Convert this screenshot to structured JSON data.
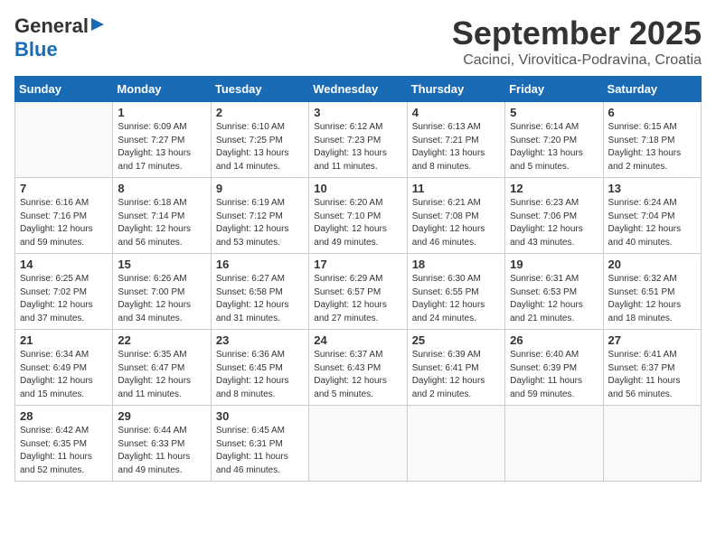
{
  "logo": {
    "general": "General",
    "blue": "Blue"
  },
  "title": "September 2025",
  "subtitle": "Cacinci, Virovitica-Podravina, Croatia",
  "days_of_week": [
    "Sunday",
    "Monday",
    "Tuesday",
    "Wednesday",
    "Thursday",
    "Friday",
    "Saturday"
  ],
  "weeks": [
    [
      {
        "day": "",
        "info": ""
      },
      {
        "day": "1",
        "info": "Sunrise: 6:09 AM\nSunset: 7:27 PM\nDaylight: 13 hours\nand 17 minutes."
      },
      {
        "day": "2",
        "info": "Sunrise: 6:10 AM\nSunset: 7:25 PM\nDaylight: 13 hours\nand 14 minutes."
      },
      {
        "day": "3",
        "info": "Sunrise: 6:12 AM\nSunset: 7:23 PM\nDaylight: 13 hours\nand 11 minutes."
      },
      {
        "day": "4",
        "info": "Sunrise: 6:13 AM\nSunset: 7:21 PM\nDaylight: 13 hours\nand 8 minutes."
      },
      {
        "day": "5",
        "info": "Sunrise: 6:14 AM\nSunset: 7:20 PM\nDaylight: 13 hours\nand 5 minutes."
      },
      {
        "day": "6",
        "info": "Sunrise: 6:15 AM\nSunset: 7:18 PM\nDaylight: 13 hours\nand 2 minutes."
      }
    ],
    [
      {
        "day": "7",
        "info": "Sunrise: 6:16 AM\nSunset: 7:16 PM\nDaylight: 12 hours\nand 59 minutes."
      },
      {
        "day": "8",
        "info": "Sunrise: 6:18 AM\nSunset: 7:14 PM\nDaylight: 12 hours\nand 56 minutes."
      },
      {
        "day": "9",
        "info": "Sunrise: 6:19 AM\nSunset: 7:12 PM\nDaylight: 12 hours\nand 53 minutes."
      },
      {
        "day": "10",
        "info": "Sunrise: 6:20 AM\nSunset: 7:10 PM\nDaylight: 12 hours\nand 49 minutes."
      },
      {
        "day": "11",
        "info": "Sunrise: 6:21 AM\nSunset: 7:08 PM\nDaylight: 12 hours\nand 46 minutes."
      },
      {
        "day": "12",
        "info": "Sunrise: 6:23 AM\nSunset: 7:06 PM\nDaylight: 12 hours\nand 43 minutes."
      },
      {
        "day": "13",
        "info": "Sunrise: 6:24 AM\nSunset: 7:04 PM\nDaylight: 12 hours\nand 40 minutes."
      }
    ],
    [
      {
        "day": "14",
        "info": "Sunrise: 6:25 AM\nSunset: 7:02 PM\nDaylight: 12 hours\nand 37 minutes."
      },
      {
        "day": "15",
        "info": "Sunrise: 6:26 AM\nSunset: 7:00 PM\nDaylight: 12 hours\nand 34 minutes."
      },
      {
        "day": "16",
        "info": "Sunrise: 6:27 AM\nSunset: 6:58 PM\nDaylight: 12 hours\nand 31 minutes."
      },
      {
        "day": "17",
        "info": "Sunrise: 6:29 AM\nSunset: 6:57 PM\nDaylight: 12 hours\nand 27 minutes."
      },
      {
        "day": "18",
        "info": "Sunrise: 6:30 AM\nSunset: 6:55 PM\nDaylight: 12 hours\nand 24 minutes."
      },
      {
        "day": "19",
        "info": "Sunrise: 6:31 AM\nSunset: 6:53 PM\nDaylight: 12 hours\nand 21 minutes."
      },
      {
        "day": "20",
        "info": "Sunrise: 6:32 AM\nSunset: 6:51 PM\nDaylight: 12 hours\nand 18 minutes."
      }
    ],
    [
      {
        "day": "21",
        "info": "Sunrise: 6:34 AM\nSunset: 6:49 PM\nDaylight: 12 hours\nand 15 minutes."
      },
      {
        "day": "22",
        "info": "Sunrise: 6:35 AM\nSunset: 6:47 PM\nDaylight: 12 hours\nand 11 minutes."
      },
      {
        "day": "23",
        "info": "Sunrise: 6:36 AM\nSunset: 6:45 PM\nDaylight: 12 hours\nand 8 minutes."
      },
      {
        "day": "24",
        "info": "Sunrise: 6:37 AM\nSunset: 6:43 PM\nDaylight: 12 hours\nand 5 minutes."
      },
      {
        "day": "25",
        "info": "Sunrise: 6:39 AM\nSunset: 6:41 PM\nDaylight: 12 hours\nand 2 minutes."
      },
      {
        "day": "26",
        "info": "Sunrise: 6:40 AM\nSunset: 6:39 PM\nDaylight: 11 hours\nand 59 minutes."
      },
      {
        "day": "27",
        "info": "Sunrise: 6:41 AM\nSunset: 6:37 PM\nDaylight: 11 hours\nand 56 minutes."
      }
    ],
    [
      {
        "day": "28",
        "info": "Sunrise: 6:42 AM\nSunset: 6:35 PM\nDaylight: 11 hours\nand 52 minutes."
      },
      {
        "day": "29",
        "info": "Sunrise: 6:44 AM\nSunset: 6:33 PM\nDaylight: 11 hours\nand 49 minutes."
      },
      {
        "day": "30",
        "info": "Sunrise: 6:45 AM\nSunset: 6:31 PM\nDaylight: 11 hours\nand 46 minutes."
      },
      {
        "day": "",
        "info": ""
      },
      {
        "day": "",
        "info": ""
      },
      {
        "day": "",
        "info": ""
      },
      {
        "day": "",
        "info": ""
      }
    ]
  ]
}
